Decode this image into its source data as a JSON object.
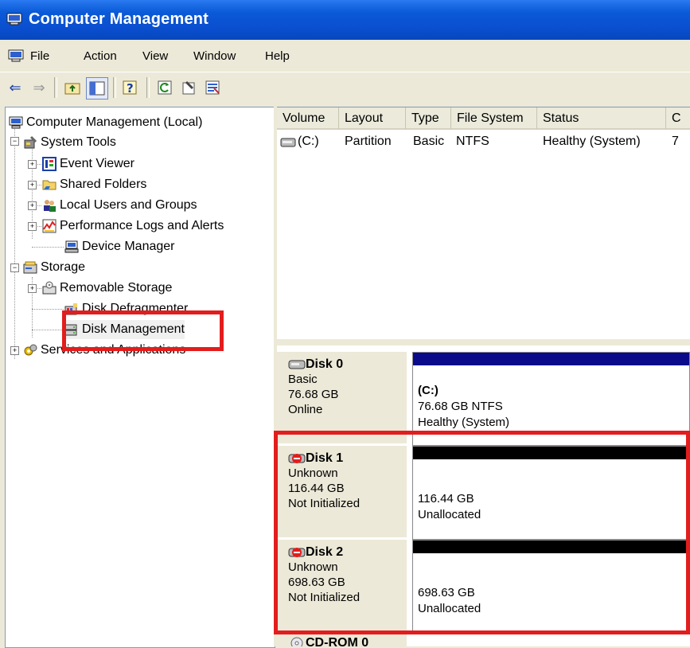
{
  "window": {
    "title": "Computer Management"
  },
  "menu": [
    "File",
    "Action",
    "View",
    "Window",
    "Help"
  ],
  "toolbar": {
    "buttons": [
      "back-arrow-icon",
      "forward-arrow-icon",
      "up-folder-icon",
      "show-hide-tree-icon",
      "help-icon",
      "refresh-icon",
      "properties-icon",
      "export-list-icon"
    ]
  },
  "tree": {
    "root": "Computer Management (Local)",
    "system_tools": "System Tools",
    "event_viewer": "Event Viewer",
    "shared_folders": "Shared Folders",
    "local_users": "Local Users and Groups",
    "perf_logs": "Performance Logs and Alerts",
    "device_manager": "Device Manager",
    "storage": "Storage",
    "removable": "Removable Storage",
    "defrag": "Disk Defragmenter",
    "disk_mgmt": "Disk Management",
    "services": "Services and Applications"
  },
  "volumes": {
    "columns": [
      "Volume",
      "Layout",
      "Type",
      "File System",
      "Status",
      "C"
    ],
    "rows": [
      {
        "volume": "(C:)",
        "layout": "Partition",
        "type": "Basic",
        "fs": "NTFS",
        "status": "Healthy (System)",
        "cap": "7"
      }
    ]
  },
  "disks": [
    {
      "name": "Disk 0",
      "type": "Basic",
      "size": "76.68 GB",
      "state": "Online",
      "part_title": "(C:)",
      "part_line1": "76.68 GB NTFS",
      "part_line2": "Healthy (System)",
      "bar_color": "#0a0a8a"
    },
    {
      "name": "Disk 1",
      "type": "Unknown",
      "size": "116.44 GB",
      "state": "Not Initialized",
      "part_title": "",
      "part_line1": "116.44 GB",
      "part_line2": "Unallocated",
      "bar_color": "#000000"
    },
    {
      "name": "Disk 2",
      "type": "Unknown",
      "size": "698.63 GB",
      "state": "Not Initialized",
      "part_title": "",
      "part_line1": "698.63 GB",
      "part_line2": "Unallocated",
      "bar_color": "#000000"
    },
    {
      "name": "CD-ROM 0"
    }
  ],
  "colors": {
    "highlight": "#e31d1d",
    "titlebar": "#0a4fd0"
  }
}
